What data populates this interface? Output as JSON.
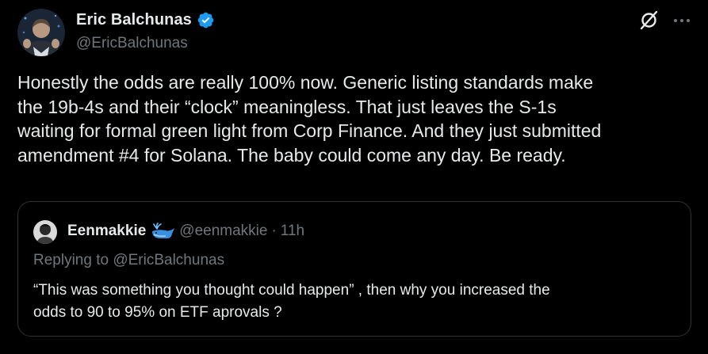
{
  "author": {
    "display_name": "Eric Balchunas",
    "handle": "@EricBalchunas",
    "verified": true,
    "avatar_icon": "user-avatar"
  },
  "header_icons": {
    "grok": "grok-icon",
    "more": "more-options-icon"
  },
  "tweet": {
    "lines": [
      "Honestly the odds are really 100% now. Generic listing standards make",
      "the 19b-4s and their “clock” meaningless. That just leaves the S-1s",
      "waiting for formal green light from Corp Finance. And they just submitted",
      "amendment #4 for Solana. The baby could come any day. Be ready."
    ]
  },
  "quote": {
    "display_name": "Eenmakkie",
    "name_emoji": "whale",
    "handle": "@eenmakkie",
    "separator": "·",
    "time": "11h",
    "replying_to": "Replying to @EricBalchunas",
    "lines": [
      "“This was something you thought could happen” , then why you increased the",
      "odds to 90 to 95% on ETF aprovals ?"
    ]
  },
  "colors": {
    "background": "#000000",
    "text_primary": "#e7e9ea",
    "text_secondary": "#71767b",
    "verified_blue": "#1d9bf0",
    "border": "#2f3336"
  }
}
